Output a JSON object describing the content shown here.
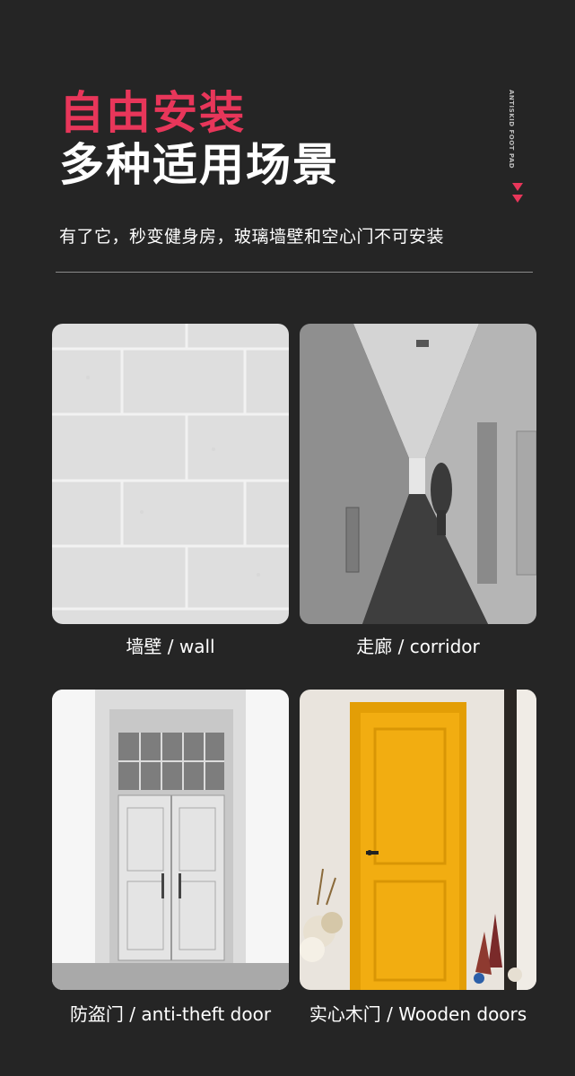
{
  "header": {
    "title_red": "自由安装",
    "title_white": "多种适用场景",
    "side_label_line1": "ANTISKID",
    "side_label_line2": "FOOT PAD",
    "subtitle": "有了它，秒变健身房，玻璃墙壁和空心门不可安装"
  },
  "scenes": [
    {
      "caption": "墙壁 / wall"
    },
    {
      "caption": "走廊 / corridor"
    },
    {
      "caption": "防盗门 / anti-theft door"
    },
    {
      "caption": "实心木门 / Wooden doors"
    }
  ],
  "colors": {
    "background": "#252525",
    "accent": "#e8365a",
    "text": "#ffffff",
    "door_yellow": "#f2ad11"
  }
}
